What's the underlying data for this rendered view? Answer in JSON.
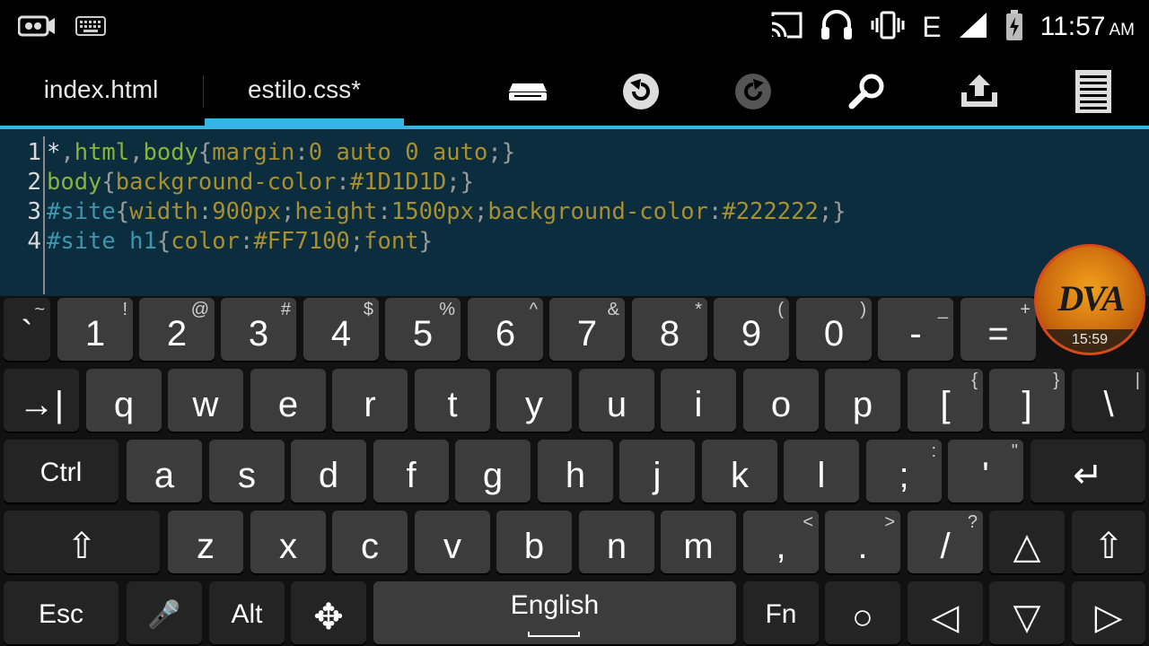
{
  "status_bar": {
    "time": "11:57",
    "ampm": "AM",
    "network": "E",
    "icons": [
      "screen-record-icon",
      "keyboard-icon",
      "cast-icon",
      "headset-icon",
      "vibrate-icon",
      "signal-icon",
      "battery-charging-icon"
    ]
  },
  "tabs": [
    {
      "label": "index.html",
      "active": false
    },
    {
      "label": "estilo.css*",
      "active": true
    }
  ],
  "toolbar_icons": [
    "keyboard-toggle-icon",
    "undo-icon",
    "redo-icon",
    "search-icon",
    "upload-icon",
    "menu-icon"
  ],
  "editor": {
    "line_numbers": [
      "1",
      "2",
      "3",
      "4"
    ],
    "lines": [
      [
        [
          "c-sel",
          "*"
        ],
        [
          "c-punc",
          ","
        ],
        [
          "c-kw",
          "html"
        ],
        [
          "c-punc",
          ","
        ],
        [
          "c-kw",
          "body"
        ],
        [
          "c-punc",
          "{"
        ],
        [
          "c-prop",
          "margin"
        ],
        [
          "c-punc",
          ":"
        ],
        [
          "c-prop",
          "0 auto 0 auto"
        ],
        [
          "c-punc",
          ";}"
        ]
      ],
      [
        [
          "c-kw",
          "body"
        ],
        [
          "c-punc",
          "{"
        ],
        [
          "c-prop",
          "background-color"
        ],
        [
          "c-punc",
          ":"
        ],
        [
          "c-prop",
          "#1D1D1D"
        ],
        [
          "c-punc",
          ";}"
        ]
      ],
      [
        [
          "c-id",
          "#site"
        ],
        [
          "c-punc",
          "{"
        ],
        [
          "c-prop",
          "width"
        ],
        [
          "c-punc",
          ":"
        ],
        [
          "c-prop",
          "900px"
        ],
        [
          "c-punc",
          ";"
        ],
        [
          "c-prop",
          "height"
        ],
        [
          "c-punc",
          ":"
        ],
        [
          "c-prop",
          "1500px"
        ],
        [
          "c-punc",
          ";"
        ],
        [
          "c-prop",
          "background-color"
        ],
        [
          "c-punc",
          ":"
        ],
        [
          "c-prop",
          "#222222"
        ],
        [
          "c-punc",
          ";}"
        ]
      ],
      [
        [
          "c-id",
          "#site h1"
        ],
        [
          "c-punc",
          "{"
        ],
        [
          "c-prop",
          "color"
        ],
        [
          "c-punc",
          ":"
        ],
        [
          "c-prop",
          "#FF7100"
        ],
        [
          "c-punc",
          ";"
        ],
        [
          "c-prop",
          "font"
        ],
        [
          "c-punc",
          "}"
        ]
      ]
    ]
  },
  "keyboard": {
    "rows": [
      [
        {
          "m": "`",
          "a": "~"
        },
        {
          "m": "1",
          "a": "!"
        },
        {
          "m": "2",
          "a": "@"
        },
        {
          "m": "3",
          "a": "#"
        },
        {
          "m": "4",
          "a": "$"
        },
        {
          "m": "5",
          "a": "%"
        },
        {
          "m": "6",
          "a": "^"
        },
        {
          "m": "7",
          "a": "&"
        },
        {
          "m": "8",
          "a": "*"
        },
        {
          "m": "9",
          "a": "("
        },
        {
          "m": "0",
          "a": ")"
        },
        {
          "m": "-",
          "a": "_"
        },
        {
          "m": "=",
          "a": "+"
        }
      ],
      [
        {
          "m": "→|",
          "a": ""
        },
        {
          "m": "q",
          "a": ""
        },
        {
          "m": "w",
          "a": ""
        },
        {
          "m": "e",
          "a": ""
        },
        {
          "m": "r",
          "a": ""
        },
        {
          "m": "t",
          "a": ""
        },
        {
          "m": "y",
          "a": ""
        },
        {
          "m": "u",
          "a": ""
        },
        {
          "m": "i",
          "a": ""
        },
        {
          "m": "o",
          "a": ""
        },
        {
          "m": "p",
          "a": ""
        },
        {
          "m": "[",
          "a": "{"
        },
        {
          "m": "]",
          "a": "}"
        },
        {
          "m": "\\",
          "a": "|"
        }
      ],
      [
        {
          "m": "Ctrl",
          "a": ""
        },
        {
          "m": "a",
          "a": ""
        },
        {
          "m": "s",
          "a": ""
        },
        {
          "m": "d",
          "a": ""
        },
        {
          "m": "f",
          "a": ""
        },
        {
          "m": "g",
          "a": ""
        },
        {
          "m": "h",
          "a": ""
        },
        {
          "m": "j",
          "a": ""
        },
        {
          "m": "k",
          "a": ""
        },
        {
          "m": "l",
          "a": ""
        },
        {
          "m": ";",
          "a": ":"
        },
        {
          "m": "'",
          "a": "\""
        },
        {
          "m": "↵",
          "a": ""
        }
      ],
      [
        {
          "m": "⇧",
          "a": ""
        },
        {
          "m": "z",
          "a": ""
        },
        {
          "m": "x",
          "a": ""
        },
        {
          "m": "c",
          "a": ""
        },
        {
          "m": "v",
          "a": ""
        },
        {
          "m": "b",
          "a": ""
        },
        {
          "m": "n",
          "a": ""
        },
        {
          "m": "m",
          "a": ""
        },
        {
          "m": ",",
          "a": "<"
        },
        {
          "m": ".",
          "a": ">"
        },
        {
          "m": "/",
          "a": "?"
        },
        {
          "m": "△",
          "a": ""
        },
        {
          "m": "⇧",
          "a": ""
        }
      ],
      [
        {
          "m": "Esc",
          "a": ""
        },
        {
          "m": "🎤",
          "a": ""
        },
        {
          "m": "Alt",
          "a": ""
        },
        {
          "m": "✥",
          "a": ""
        },
        {
          "m": "English",
          "a": ""
        },
        {
          "m": "Fn",
          "a": ""
        },
        {
          "m": "○",
          "a": ""
        },
        {
          "m": "◁",
          "a": ""
        },
        {
          "m": "▽",
          "a": ""
        },
        {
          "m": "▷",
          "a": ""
        }
      ]
    ]
  },
  "badge": {
    "logo_text": "DVA",
    "time": "15:59"
  }
}
